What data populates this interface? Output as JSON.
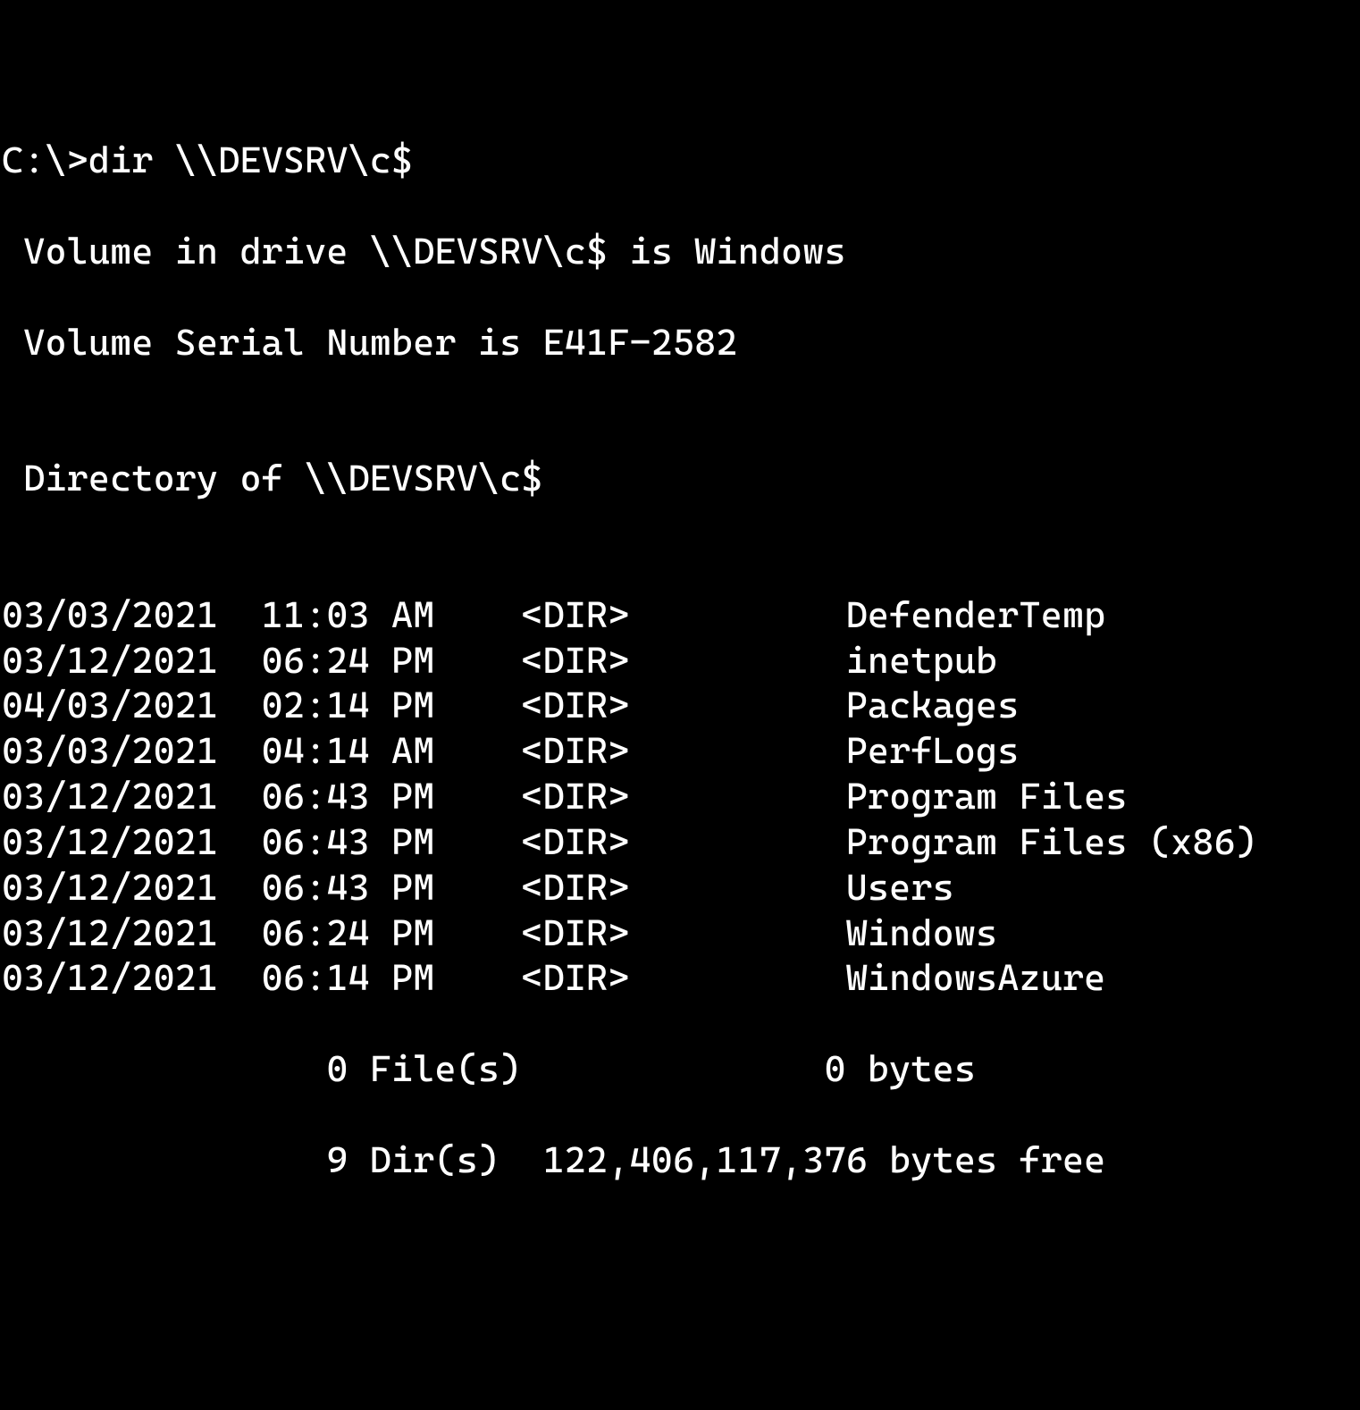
{
  "prompt": "C:\\>",
  "command": "dir \\\\DEVSRV\\c$",
  "volume_line": " Volume in drive \\\\DEVSRV\\c$ is Windows",
  "serial_line": " Volume Serial Number is E41F-2582",
  "blank": "",
  "directory_of": " Directory of \\\\DEVSRV\\c$",
  "entries": [
    {
      "date": "03/03/2021",
      "time": "11:03 AM",
      "type": "<DIR>",
      "name": "DefenderTemp"
    },
    {
      "date": "03/12/2021",
      "time": "06:24 PM",
      "type": "<DIR>",
      "name": "inetpub"
    },
    {
      "date": "04/03/2021",
      "time": "02:14 PM",
      "type": "<DIR>",
      "name": "Packages"
    },
    {
      "date": "03/03/2021",
      "time": "04:14 AM",
      "type": "<DIR>",
      "name": "PerfLogs"
    },
    {
      "date": "03/12/2021",
      "time": "06:43 PM",
      "type": "<DIR>",
      "name": "Program Files"
    },
    {
      "date": "03/12/2021",
      "time": "06:43 PM",
      "type": "<DIR>",
      "name": "Program Files (x86)"
    },
    {
      "date": "03/12/2021",
      "time": "06:43 PM",
      "type": "<DIR>",
      "name": "Users"
    },
    {
      "date": "03/12/2021",
      "time": "06:24 PM",
      "type": "<DIR>",
      "name": "Windows"
    },
    {
      "date": "03/12/2021",
      "time": "06:14 PM",
      "type": "<DIR>",
      "name": "WindowsAzure"
    }
  ],
  "summary_files": "               0 File(s)              0 bytes",
  "summary_dirs": "               9 Dir(s)  122,406,117,376 bytes free"
}
